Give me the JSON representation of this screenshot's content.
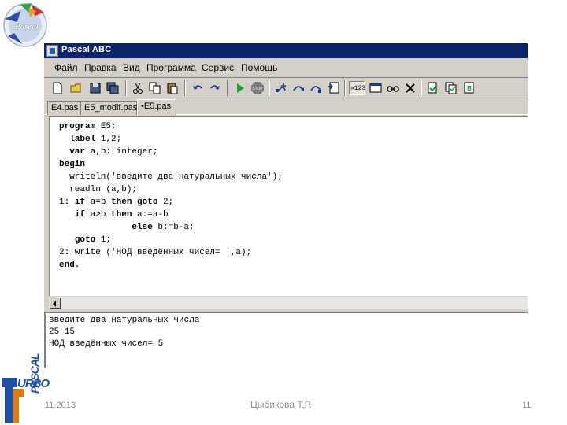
{
  "logo_top": {
    "text": "Pascal"
  },
  "logo_bottom": {
    "text_top": "URBO",
    "text_vertical": "PASCAL"
  },
  "window": {
    "title": "Pascal ABC",
    "menu": [
      "Файл",
      "Правка",
      "Вид",
      "Программа",
      "Сервис",
      "Помощь"
    ],
    "toolbar": {
      "buttons": [
        "new-icon",
        "open-icon",
        "save-icon",
        "save-all-icon",
        "cut-icon",
        "copy-icon",
        "paste-icon",
        "undo-icon",
        "redo-icon",
        "run-icon",
        "stop-icon",
        "step-into-icon",
        "step-over-icon",
        "step-out-icon",
        "watch-icon",
        "format-icon",
        "window-icon",
        "glasses-icon",
        "close-x-icon",
        "compile-icon",
        "compile-all-icon",
        "build-icon"
      ],
      "format_label": "»123"
    },
    "tabs": [
      {
        "label": "E4.pas",
        "active": false
      },
      {
        "label": "E5_modif.pas",
        "active": false
      },
      {
        "label": "•E5.pas",
        "active": true
      }
    ],
    "code": [
      [
        {
          "t": "program",
          "b": true
        },
        {
          "t": " E5;",
          "b": false
        }
      ],
      [
        {
          "t": "  label",
          "b": true
        },
        {
          "t": " 1,2;",
          "b": false
        }
      ],
      [
        {
          "t": "  var",
          "b": true
        },
        {
          "t": " a,b: integer;",
          "b": false
        }
      ],
      [
        {
          "t": "begin",
          "b": true
        }
      ],
      [
        {
          "t": "  writeln('введите два натуральных числа');",
          "b": false
        }
      ],
      [
        {
          "t": "  readln (a,b);",
          "b": false
        }
      ],
      [
        {
          "t": "1: ",
          "b": false
        },
        {
          "t": "if",
          "b": true
        },
        {
          "t": " a=b ",
          "b": false
        },
        {
          "t": "then",
          "b": true
        },
        {
          "t": " ",
          "b": false
        },
        {
          "t": "goto",
          "b": true
        },
        {
          "t": " 2;",
          "b": false
        }
      ],
      [
        {
          "t": "   ",
          "b": false
        },
        {
          "t": "if",
          "b": true
        },
        {
          "t": " a>b ",
          "b": false
        },
        {
          "t": "then",
          "b": true
        },
        {
          "t": " a:=a-b",
          "b": false
        }
      ],
      [
        {
          "t": "              ",
          "b": false
        },
        {
          "t": "else",
          "b": true
        },
        {
          "t": " b:=b-a;",
          "b": false
        }
      ],
      [
        {
          "t": "   ",
          "b": false
        },
        {
          "t": "goto",
          "b": true
        },
        {
          "t": " 1;",
          "b": false
        }
      ],
      [
        {
          "t": "2: write ('НОД введённых чисел= ',a);",
          "b": false
        }
      ],
      [
        {
          "t": "end.",
          "b": true
        }
      ]
    ],
    "output": [
      "введите два натуральных числа",
      "25 15",
      "НОД введённых чисел= 5"
    ]
  },
  "footer": {
    "date": "11.2013",
    "author": "Цыбикова Т.Р.",
    "page": "11"
  },
  "colors": {
    "titlebar": "#0a246a",
    "chrome": "#d4d0c8",
    "footer_text": "#8c8c8c",
    "logo_blue": "#1e4fa3"
  }
}
